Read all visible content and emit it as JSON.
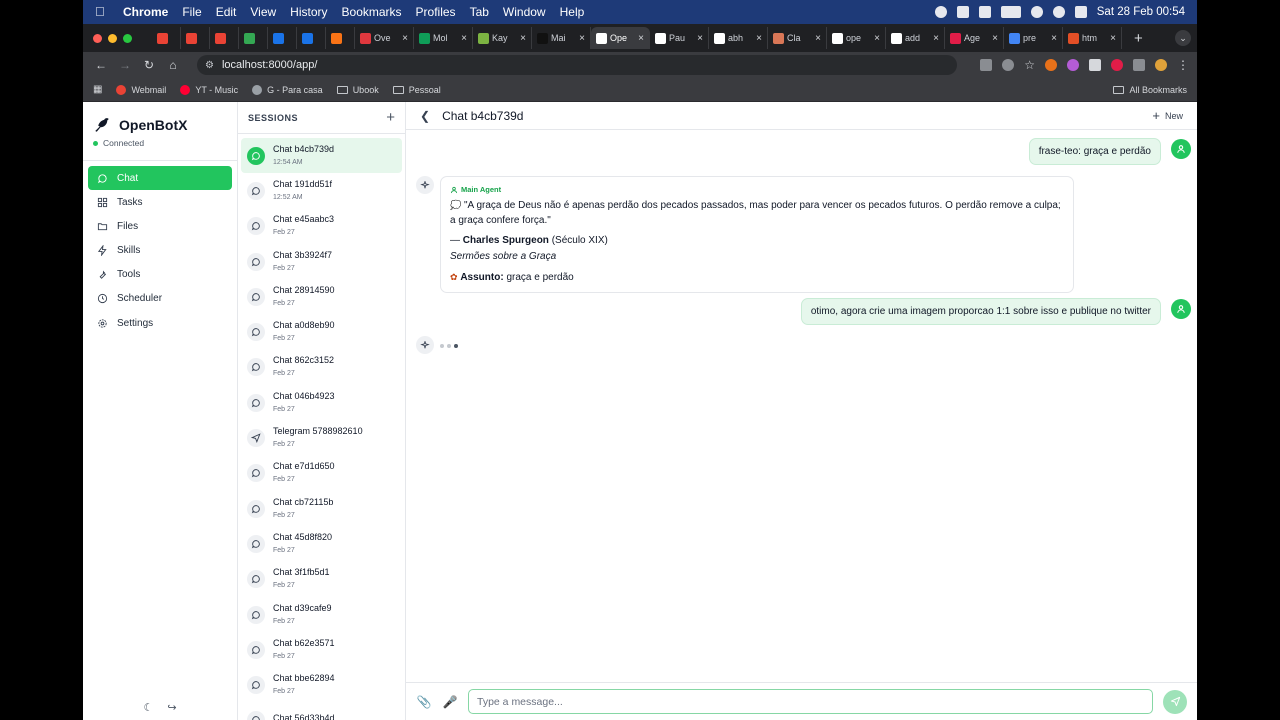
{
  "menubar": {
    "app": "Chrome",
    "items": [
      "File",
      "Edit",
      "View",
      "History",
      "Bookmarks",
      "Profiles",
      "Tab",
      "Window",
      "Help"
    ],
    "datetime": "Sat 28 Feb  00:54"
  },
  "tabs": [
    {
      "label": "",
      "icon": "gmail-icon",
      "color": "#ea4335"
    },
    {
      "label": "",
      "icon": "gmail-icon",
      "color": "#ea4335"
    },
    {
      "label": "",
      "icon": "gmail-icon",
      "color": "#ea4335"
    },
    {
      "label": "",
      "icon": "green-app-icon",
      "color": "#34a853"
    },
    {
      "label": "",
      "icon": "blue-app-icon",
      "color": "#1a73e8"
    },
    {
      "label": "",
      "icon": "blue-app-icon",
      "color": "#1a73e8"
    },
    {
      "label": "",
      "icon": "orange-app-icon",
      "color": "#f97316"
    },
    {
      "label": "Ove",
      "icon": "bc-icon",
      "color": "#e0383e"
    },
    {
      "label": "Mol",
      "icon": "sheets-icon",
      "color": "#0f9d58"
    },
    {
      "label": "Kay",
      "icon": "kay-icon",
      "color": "#7cb342"
    },
    {
      "label": "Mai",
      "icon": "butterfly-icon",
      "color": "#111111"
    },
    {
      "label": "Ope",
      "icon": "openbotx-icon",
      "color": "#ffffff",
      "active": true
    },
    {
      "label": "Pau",
      "icon": "x-icon",
      "color": "#ffffff"
    },
    {
      "label": "abh",
      "icon": "github-icon",
      "color": "#ffffff"
    },
    {
      "label": "Cla",
      "icon": "claude-icon",
      "color": "#d97757"
    },
    {
      "label": "ope",
      "icon": "github-icon",
      "color": "#ffffff"
    },
    {
      "label": "add",
      "icon": "github-icon",
      "color": "#ffffff"
    },
    {
      "label": "Age",
      "icon": "hat-icon",
      "color": "#e11d48"
    },
    {
      "label": "pre",
      "icon": "google-icon",
      "color": "#4285f4"
    },
    {
      "label": "htm",
      "icon": "html-icon",
      "color": "#e34f26"
    }
  ],
  "address": {
    "url": "localhost:8000/app/"
  },
  "bookmarks": [
    {
      "label": "Webmail",
      "icon": "gmail-icon",
      "color": "#ea4335"
    },
    {
      "label": "YT - Music",
      "icon": "youtube-icon",
      "color": "#ff0033"
    },
    {
      "label": "G - Para casa",
      "icon": "globe-icon",
      "color": "#9aa0a6"
    },
    {
      "label": "Ubook",
      "icon": "folder-icon",
      "color": ""
    },
    {
      "label": "Pessoal",
      "icon": "folder-icon",
      "color": ""
    }
  ],
  "all_bookmarks": "All Bookmarks",
  "sidebar": {
    "brand": "OpenBotX",
    "status": "Connected",
    "nav": [
      {
        "label": "Chat",
        "icon": "chat-icon",
        "active": true
      },
      {
        "label": "Tasks",
        "icon": "grid-icon"
      },
      {
        "label": "Files",
        "icon": "folder-icon"
      },
      {
        "label": "Skills",
        "icon": "bolt-icon"
      },
      {
        "label": "Tools",
        "icon": "wrench-icon"
      },
      {
        "label": "Scheduler",
        "icon": "clock-icon"
      },
      {
        "label": "Settings",
        "icon": "gear-icon"
      }
    ]
  },
  "sessions": {
    "title": "SESSIONS",
    "items": [
      {
        "name": "Chat b4cb739d",
        "time": "12:54 AM",
        "active": true,
        "icon": "chat"
      },
      {
        "name": "Chat 191dd51f",
        "time": "12:52 AM",
        "icon": "chat"
      },
      {
        "name": "Chat e45aabc3",
        "time": "Feb 27",
        "icon": "chat"
      },
      {
        "name": "Chat 3b3924f7",
        "time": "Feb 27",
        "icon": "chat"
      },
      {
        "name": "Chat 28914590",
        "time": "Feb 27",
        "icon": "chat"
      },
      {
        "name": "Chat a0d8eb90",
        "time": "Feb 27",
        "icon": "chat"
      },
      {
        "name": "Chat 862c3152",
        "time": "Feb 27",
        "icon": "chat"
      },
      {
        "name": "Chat 046b4923",
        "time": "Feb 27",
        "icon": "chat"
      },
      {
        "name": "Telegram 5788982610",
        "time": "Feb 27",
        "icon": "send"
      },
      {
        "name": "Chat e7d1d650",
        "time": "Feb 27",
        "icon": "chat"
      },
      {
        "name": "Chat cb72115b",
        "time": "Feb 27",
        "icon": "chat"
      },
      {
        "name": "Chat 45d8f820",
        "time": "Feb 27",
        "icon": "chat"
      },
      {
        "name": "Chat 3f1fb5d1",
        "time": "Feb 27",
        "icon": "chat"
      },
      {
        "name": "Chat d39cafe9",
        "time": "Feb 27",
        "icon": "chat"
      },
      {
        "name": "Chat b62e3571",
        "time": "Feb 27",
        "icon": "chat"
      },
      {
        "name": "Chat bbe62894",
        "time": "Feb 27",
        "icon": "chat"
      },
      {
        "name": "Chat 56d33b4d",
        "time": "",
        "icon": "chat"
      }
    ]
  },
  "chat": {
    "title": "Chat b4cb739d",
    "new_label": "New",
    "messages": {
      "user1": "frase-teo: graça e perdão",
      "agent_label": "Main Agent",
      "quote": "\"A graça de Deus não é apenas perdão dos pecados passados, mas poder para vencer os pecados futuros. O perdão remove a culpa; a graça confere força.\"",
      "author_prefix": "— ",
      "author": "Charles Spurgeon",
      "author_suffix": " (Século XIX)",
      "source": "Sermões sobre a Graça",
      "topic_label": "Assunto:",
      "topic": " graça e perdão",
      "user2": "otimo, agora crie uma imagem proporcao 1:1 sobre isso e publique no twitter"
    },
    "composer_placeholder": "Type a message..."
  },
  "colors": {
    "accent": "#22c55e",
    "menubar": "#1e3a78"
  }
}
